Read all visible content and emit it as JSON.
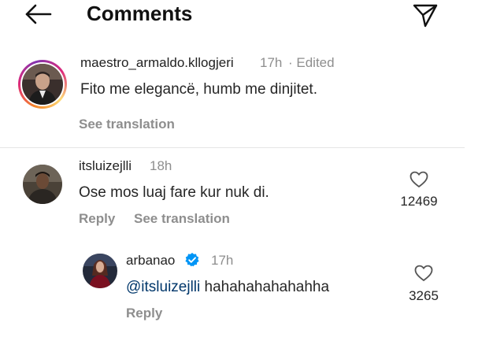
{
  "header": {
    "title": "Comments",
    "back_icon": "arrow-left-icon",
    "share_icon": "paper-plane-icon"
  },
  "comments": [
    {
      "username": "maestro_armaldo.kllogjeri",
      "time": "17h",
      "edited": "· Edited",
      "text": "Fito me elegancë, humb me dinjitet.",
      "see_translation": "See translation",
      "has_story_ring": true
    },
    {
      "username": "itsluizejlli",
      "time": "18h",
      "text": "Ose mos luaj fare kur nuk di.",
      "reply_label": "Reply",
      "see_translation": "See translation",
      "likes": "12469"
    },
    {
      "username": "arbanao",
      "verified": true,
      "time": "17h",
      "mention": "@itsluizejlli",
      "text": " hahahahahahahha",
      "reply_label": "Reply",
      "likes": "3265"
    }
  ],
  "colors": {
    "text": "#262626",
    "muted": "#8e8e8e",
    "mention": "#00376b",
    "verified": "#0095f6"
  }
}
